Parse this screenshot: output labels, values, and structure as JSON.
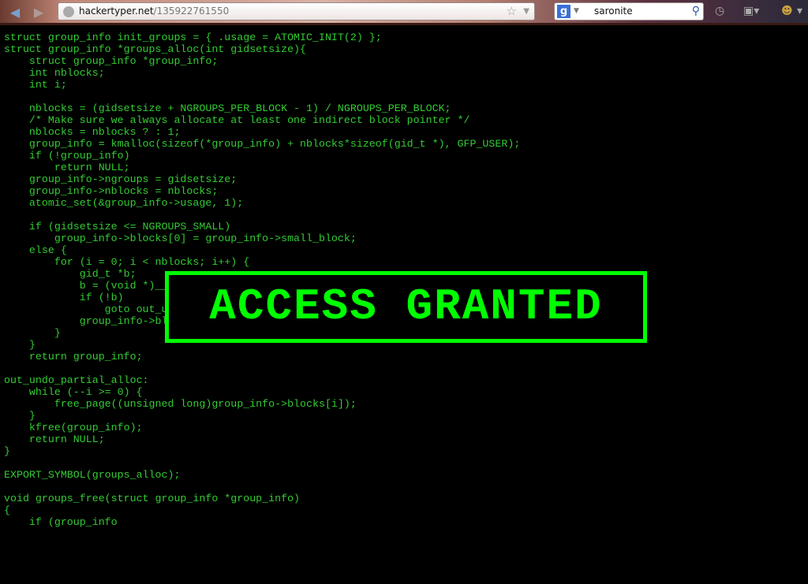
{
  "browser": {
    "url_domain": "hackertyper.net",
    "url_path": "/135922761550",
    "search_engine": "Google",
    "search_query": "saronite"
  },
  "code_lines": [
    "struct group_info init_groups = { .usage = ATOMIC_INIT(2) };",
    "struct group_info *groups_alloc(int gidsetsize){",
    "    struct group_info *group_info;",
    "    int nblocks;",
    "    int i;",
    "",
    "    nblocks = (gidsetsize + NGROUPS_PER_BLOCK - 1) / NGROUPS_PER_BLOCK;",
    "    /* Make sure we always allocate at least one indirect block pointer */",
    "    nblocks = nblocks ? : 1;",
    "    group_info = kmalloc(sizeof(*group_info) + nblocks*sizeof(gid_t *), GFP_USER);",
    "    if (!group_info)",
    "        return NULL;",
    "    group_info->ngroups = gidsetsize;",
    "    group_info->nblocks = nblocks;",
    "    atomic_set(&group_info->usage, 1);",
    "",
    "    if (gidsetsize <= NGROUPS_SMALL)",
    "        group_info->blocks[0] = group_info->small_block;",
    "    else {",
    "        for (i = 0; i < nblocks; i++) {",
    "            gid_t *b;",
    "            b = (void *)__",
    "            if (!b)",
    "                goto out_u",
    "            group_info->bl",
    "        }",
    "    }",
    "    return group_info;",
    "",
    "out_undo_partial_alloc:",
    "    while (--i >= 0) {",
    "        free_page((unsigned long)group_info->blocks[i]);",
    "    }",
    "    kfree(group_info);",
    "    return NULL;",
    "}",
    "",
    "EXPORT_SYMBOL(groups_alloc);",
    "",
    "void groups_free(struct group_info *group_info)",
    "{",
    "    if (group_info"
  ],
  "overlay": {
    "text": "ACCESS GRANTED",
    "color": "#00ff00"
  },
  "colors": {
    "code_text": "#33cc33",
    "background": "#000000"
  }
}
